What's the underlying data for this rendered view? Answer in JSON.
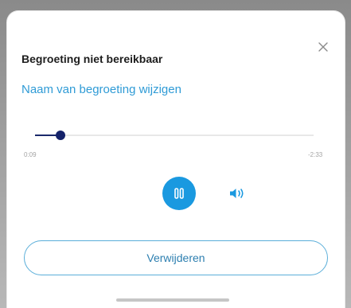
{
  "dialog": {
    "title": "Begroeting niet bereikbaar",
    "rename_link": "Naam van begroeting wijzigen",
    "close_icon": "close-icon"
  },
  "player": {
    "elapsed": "0:09",
    "remaining": "-2:33",
    "progress_fraction": 0.09,
    "pause_icon": "pause-icon",
    "speaker_icon": "speaker-icon"
  },
  "actions": {
    "delete_label": "Verwijderen"
  },
  "colors": {
    "accent": "#1a99e0",
    "link": "#2f9bd6",
    "slider": "#14226a",
    "button_border": "#5aaed9"
  }
}
